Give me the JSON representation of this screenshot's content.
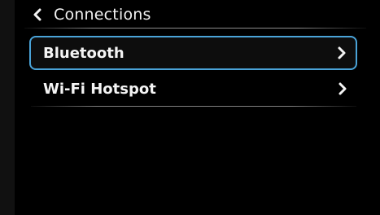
{
  "header": {
    "title": "Connections",
    "back_icon": "chevron-left-icon"
  },
  "menu": {
    "items": [
      {
        "label": "Bluetooth",
        "icon": "chevron-right-icon",
        "selected": true
      },
      {
        "label": "Wi-Fi Hotspot",
        "icon": "chevron-right-icon",
        "selected": false
      }
    ]
  },
  "colors": {
    "background": "#000000",
    "text": "#f2f2f2",
    "selection_border": "#4aa3d8"
  }
}
